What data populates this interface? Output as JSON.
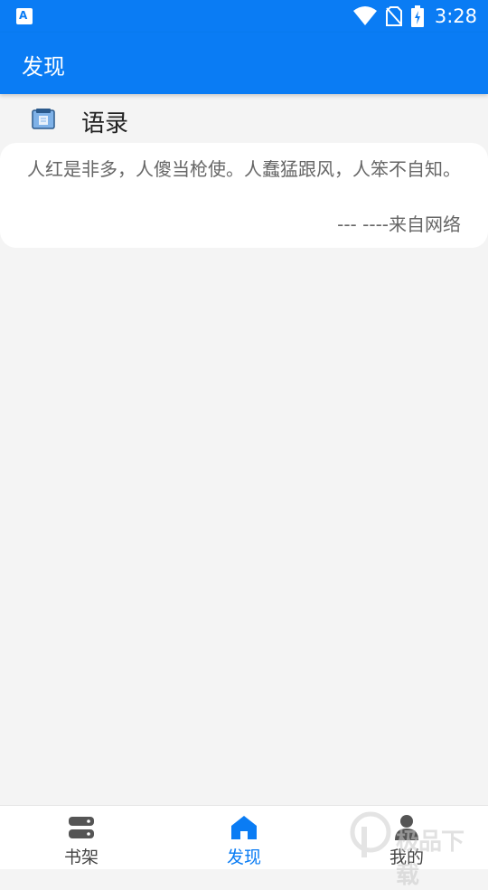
{
  "status_bar": {
    "time": "3:28",
    "icons": [
      "app-notification-icon",
      "wifi-icon",
      "no-sim-icon",
      "battery-charging-icon"
    ]
  },
  "app_bar": {
    "title": "发现"
  },
  "section": {
    "title": "语录",
    "icon": "clipboard-icon"
  },
  "quote": {
    "text": "人红是非多，人傻当枪使。人蠢猛跟风，人笨不自知。",
    "source": "--- ----来自网络"
  },
  "bottom_nav": {
    "items": [
      {
        "label": "书架",
        "icon": "bookshelf-icon",
        "active": false
      },
      {
        "label": "发现",
        "icon": "home-icon",
        "active": true
      },
      {
        "label": "我的",
        "icon": "person-icon",
        "active": false
      }
    ]
  },
  "watermark": {
    "text": "极品下载"
  },
  "colors": {
    "primary": "#0a7cf4",
    "background": "#f4f4f4",
    "card": "#ffffff",
    "text_muted": "#666666"
  }
}
